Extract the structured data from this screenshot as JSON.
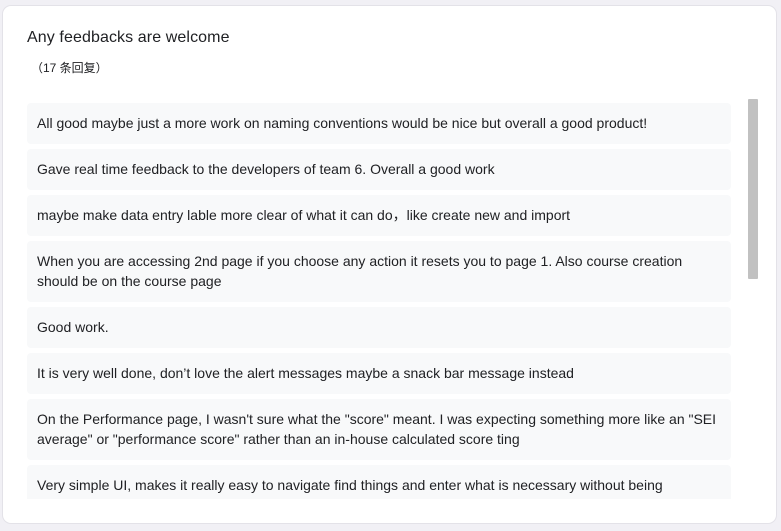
{
  "question": {
    "title": "Any feedbacks are welcome",
    "response_count": "（17 条回复）"
  },
  "responses": [
    "All good maybe just a more work on naming conventions would be nice but overall a good product!",
    "Gave real time feedback to the developers of team 6. Overall a good work",
    "maybe make data entry lable more clear of what it can do，like create new and import",
    "When you are accessing 2nd page if you choose any action it resets you to page 1. Also course creation should be on the course page",
    "Good work.",
    "It is very well done, don’t love the alert messages maybe a snack bar message instead",
    "On the Performance page, I wasn't sure what the \"score\" meant. I was expecting something more like an \"SEI average\" or \"performance score\" rather than an in-house calculated score ting",
    "Very simple UI, makes it really easy to navigate find things and enter what is necessary without being overwhelming. Creating a course could be more intuitive. For certain pages tooltips to help the user know"
  ]
}
